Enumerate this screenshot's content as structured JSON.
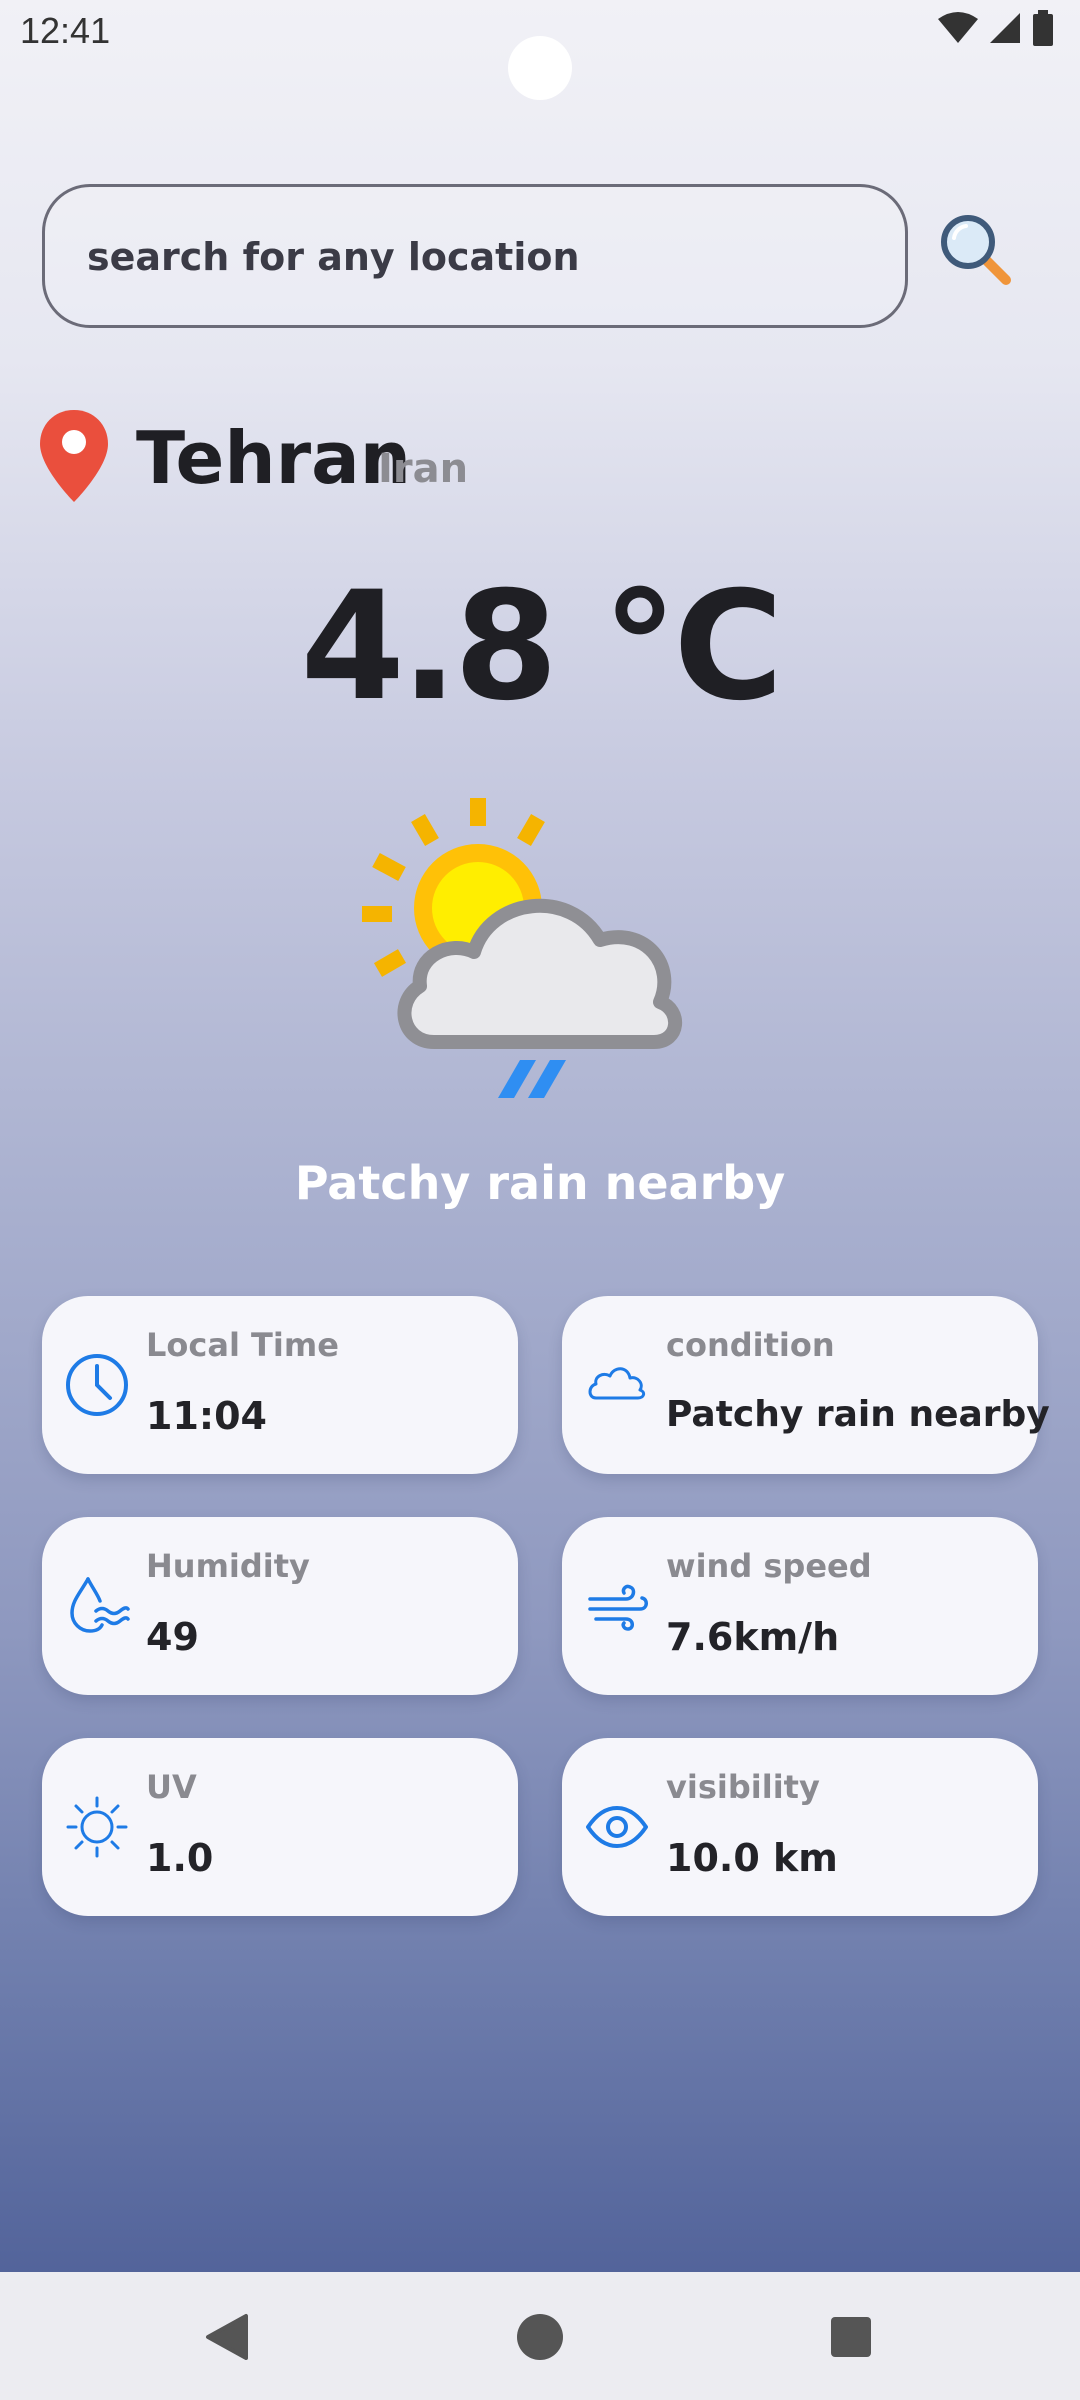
{
  "status_bar": {
    "time": "12:41"
  },
  "search": {
    "placeholder": "search for any location"
  },
  "location": {
    "city": "Tehran",
    "country": "Iran"
  },
  "current": {
    "temperature": "4.8 °C",
    "condition": "Patchy rain nearby",
    "icon": "sun-cloud-rain-icon"
  },
  "cards": {
    "local_time": {
      "label": "Local Time",
      "value": "11:04",
      "icon": "clock-icon"
    },
    "condition": {
      "label": "condition",
      "value": "Patchy rain nearby",
      "icon": "cloud-icon"
    },
    "humidity": {
      "label": "Humidity",
      "value": "49",
      "icon": "humidity-icon"
    },
    "wind_speed": {
      "label": "wind speed",
      "value": "7.6km/h",
      "icon": "wind-icon"
    },
    "uv": {
      "label": "UV",
      "value": "1.0",
      "icon": "sun-icon"
    },
    "visibility": {
      "label": "visibility",
      "value": "10.0 km",
      "icon": "eye-icon"
    }
  },
  "colors": {
    "accent": "#1e7be6",
    "pin": "#ea4f3d",
    "sun": "#ffc107",
    "rain": "#2f8ef2"
  }
}
